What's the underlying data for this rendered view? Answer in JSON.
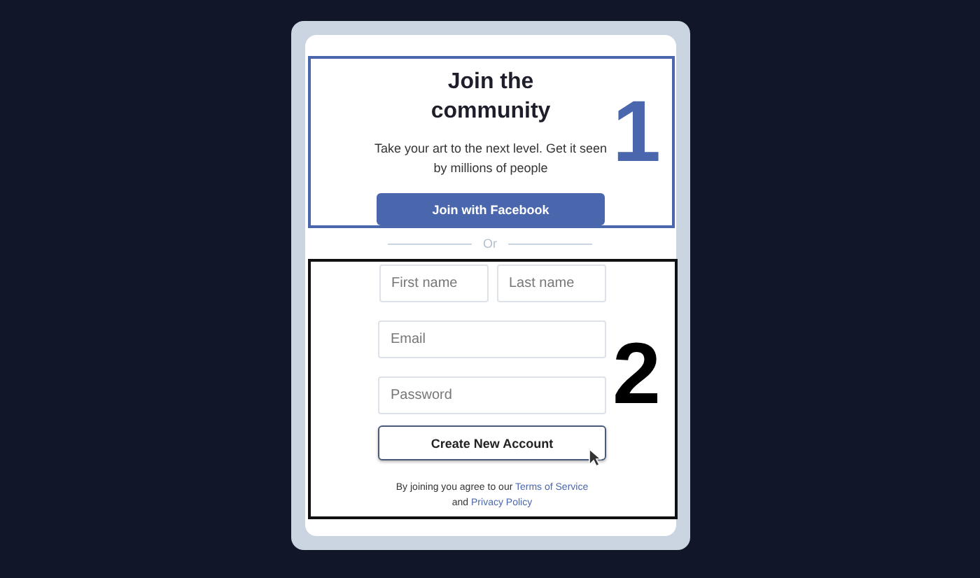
{
  "hero": {
    "title": "Join the community",
    "subtitle": "Take your art to the next level. Get it seen by millions of people",
    "button": "Join with Facebook",
    "marker": "1"
  },
  "divider": "Or",
  "form": {
    "fields": [
      {
        "placeholder": "First name"
      },
      {
        "placeholder": "Last name"
      },
      {
        "placeholder": "Email"
      },
      {
        "placeholder": "Password"
      }
    ],
    "button": "Create New Account",
    "marker": "2",
    "terms": {
      "prefix": "By joining you agree to our ",
      "link1": "Terms of Service",
      "middle": " and ",
      "link2": "Privacy Policy"
    }
  }
}
